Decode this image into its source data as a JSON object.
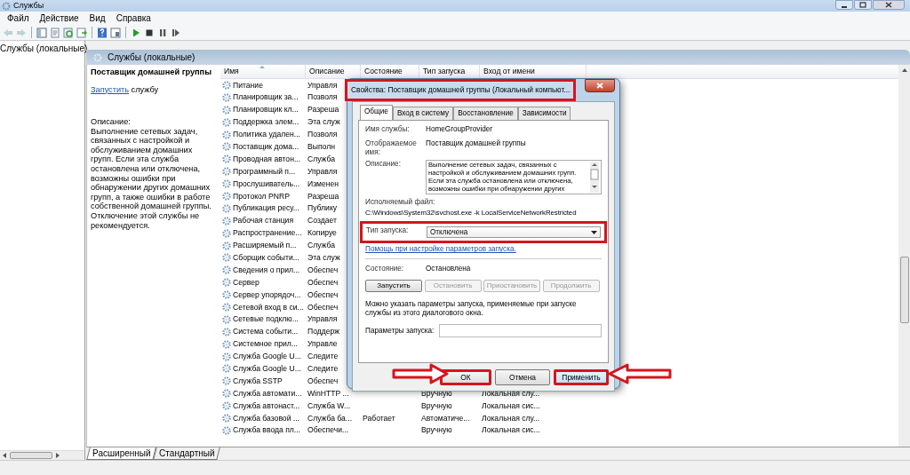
{
  "window": {
    "title": "Службы"
  },
  "menu": [
    "Файл",
    "Действие",
    "Вид",
    "Справка"
  ],
  "toolbar": [
    {
      "kind": "back",
      "disabled": true
    },
    {
      "kind": "forward",
      "disabled": true
    },
    {
      "kind": "tree",
      "disabled": false
    },
    {
      "kind": "properties",
      "disabled": false
    },
    {
      "kind": "refresh",
      "disabled": false
    },
    {
      "kind": "export",
      "disabled": false
    },
    {
      "kind": "help",
      "disabled": false
    },
    {
      "kind": "view",
      "disabled": false
    },
    {
      "kind": "start",
      "disabled": false
    },
    {
      "kind": "stop",
      "disabled": false
    },
    {
      "kind": "pause",
      "disabled": false
    },
    {
      "kind": "resume",
      "disabled": false
    }
  ],
  "tree": [
    {
      "label": "Службы (локальные)",
      "selected": false
    }
  ],
  "pane_header": "Службы (локальные)",
  "details": {
    "title": "Поставщик домашней группы",
    "action_link": "Запустить",
    "action_text": "службу",
    "description_label": "Описание:",
    "description": "Выполнение сетевых задач, связанных с настройкой и обслуживанием домашних групп. Если эта служба остановлена или отключена, возможны ошибки при обнаружении других домашних групп, а также ошибки в работе собственной домашней группы. Отключение этой службы не рекомендуется."
  },
  "table": {
    "columns": [
      "Имя",
      "Описание",
      "Состояние",
      "Тип запуска",
      "Вход от имени"
    ],
    "rows": [
      {
        "cells": [
          "Питание",
          "Управля"
        ]
      },
      {
        "cells": [
          "Планировщик за...",
          "Позволя"
        ]
      },
      {
        "cells": [
          "Планировщик кл...",
          "Разреша"
        ]
      },
      {
        "cells": [
          "Поддержка элем...",
          "Эта служ"
        ]
      },
      {
        "cells": [
          "Политика удален...",
          "Позволя"
        ]
      },
      {
        "cells": [
          "Поставщик дома...",
          "Выполн"
        ]
      },
      {
        "cells": [
          "Проводная автон...",
          "Служба"
        ]
      },
      {
        "cells": [
          "Программный п...",
          "Управля"
        ]
      },
      {
        "cells": [
          "Прослушиватель...",
          "Изменен"
        ]
      },
      {
        "cells": [
          "Протокол PNRP",
          "Разреша"
        ]
      },
      {
        "cells": [
          "Публикация ресу...",
          "Публику"
        ]
      },
      {
        "cells": [
          "Рабочая станция",
          "Создает"
        ]
      },
      {
        "cells": [
          "Распространение...",
          "Копируе"
        ]
      },
      {
        "cells": [
          "Расширяемый п...",
          "Служба"
        ]
      },
      {
        "cells": [
          "Сборщик событи...",
          "Эта служ"
        ]
      },
      {
        "cells": [
          "Сведения о прил...",
          "Обеспеч"
        ]
      },
      {
        "cells": [
          "Сервер",
          "Обеспеч"
        ]
      },
      {
        "cells": [
          "Сервер упорядоч...",
          "Обеспеч"
        ]
      },
      {
        "cells": [
          "Сетевой вход в си...",
          "Обеспеч"
        ]
      },
      {
        "cells": [
          "Сетевые подклю...",
          "Управля"
        ]
      },
      {
        "cells": [
          "Система событи...",
          "Поддерж"
        ]
      },
      {
        "cells": [
          "Системное прил...",
          "Управле"
        ]
      },
      {
        "cells": [
          "Служба Google U...",
          "Следите"
        ]
      },
      {
        "cells": [
          "Служба Google U...",
          "Следите"
        ]
      },
      {
        "cells": [
          "Служба SSTP",
          "Обеспеч"
        ]
      },
      {
        "cells": [
          "Служба автомати...",
          "WinHTTP ...",
          "",
          "Вручную",
          "Локальная слу..."
        ]
      },
      {
        "cells": [
          "Служба автонаст...",
          "Служба W...",
          "",
          "Вручную",
          "Локальная сис..."
        ]
      },
      {
        "cells": [
          "Служба базовой ...",
          "Служба ба...",
          "Работает",
          "Автоматиче...",
          "Локальная слу..."
        ]
      },
      {
        "cells": [
          "Служба ввода пл...",
          "Обеспечи...",
          "",
          "Вручную",
          "Локальная сис..."
        ]
      }
    ]
  },
  "view_tabs": [
    {
      "label": "Расширенный",
      "selected": true
    },
    {
      "label": "Стандартный",
      "selected": false
    }
  ],
  "dialog": {
    "title": "Свойства: Поставщик домашней группы (Локальный компьют...",
    "title_highlighted": true,
    "tabs": [
      {
        "label": "Общие",
        "selected": true
      },
      {
        "label": "Вход в систему",
        "selected": false
      },
      {
        "label": "Восстановление",
        "selected": false
      },
      {
        "label": "Зависимости",
        "selected": false
      }
    ],
    "service_name_label": "Имя службы:",
    "service_name": "HomeGroupProvider",
    "display_name_label": "Отображаемое имя:",
    "display_name": "Поставщик домашней группы",
    "description_label": "Описание:",
    "description": "Выполнение сетевых задач, связанных с настройкой и обслуживанием домашних групп. Если эта служба остановлена или отключена, возможны ошибки при обнаружении других",
    "exe_label": "Исполняемый файл:",
    "exe_path": "C:\\Windows\\System32\\svchost.exe -k LocalServiceNetworkRestricted",
    "startup_label": "Тип запуска:",
    "startup_value": "Отключена",
    "startup_highlighted": true,
    "help_link": "Помощь при настройке параметров запуска.",
    "status_label": "Состояние:",
    "status_value": "Остановлена",
    "service_buttons": [
      {
        "label": "Запустить",
        "disabled": false
      },
      {
        "label": "Остановить",
        "disabled": true
      },
      {
        "label": "Приостановить",
        "disabled": true
      },
      {
        "label": "Продолжить",
        "disabled": true
      }
    ],
    "hint": "Можно указать параметры запуска, применяемые при запуске службы из этого диалогового окна.",
    "params_label": "Параметры запуска:",
    "buttons": [
      {
        "label": "ОК",
        "highlighted": true,
        "default": false
      },
      {
        "label": "Отмена",
        "highlighted": false,
        "default": false
      },
      {
        "label": "Применить",
        "highlighted": true,
        "default": true
      }
    ]
  }
}
